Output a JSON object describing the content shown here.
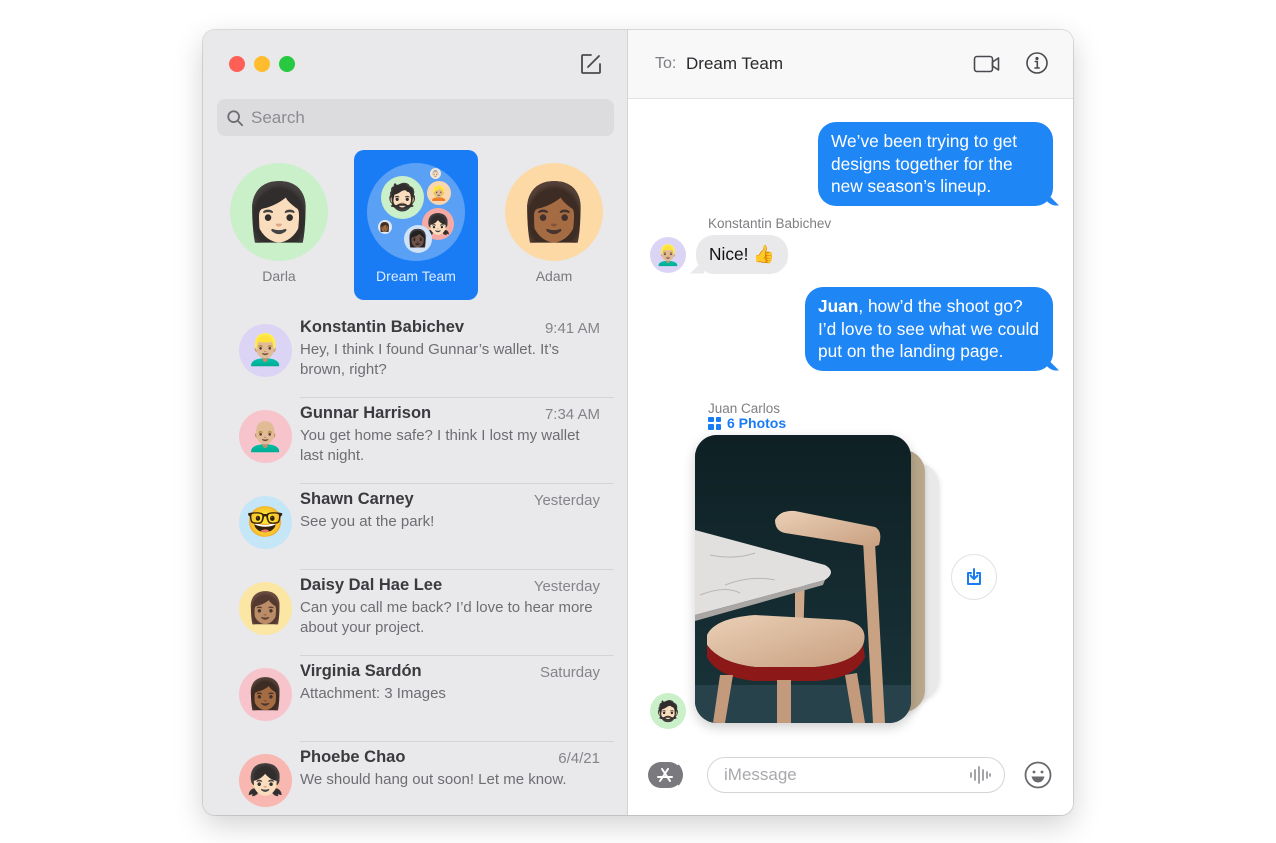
{
  "window": {
    "traffic_lights": [
      "close",
      "minimize",
      "zoom"
    ]
  },
  "sidebar": {
    "compose_icon": "compose-icon",
    "search": {
      "placeholder": "Search",
      "value": ""
    },
    "pinned": [
      {
        "label": "Darla",
        "emoji": "👩🏻",
        "bg": "#c9f0c9",
        "active": false
      },
      {
        "label": "Dream Team",
        "emoji": "",
        "bg": "#5aa1f6",
        "active": true
      },
      {
        "label": "Adam",
        "emoji": "👩🏾",
        "bg": "#fdd9a6",
        "active": false
      }
    ],
    "conversations": [
      {
        "name": "Konstantin Babichev",
        "time": "9:41 AM",
        "preview": "Hey, I think I found Gunnar’s wallet. It’s brown, right?",
        "emoji": "👱🏼‍♂️",
        "bg": "#dcd4f5"
      },
      {
        "name": "Gunnar Harrison",
        "time": "7:34 AM",
        "preview": "You get home safe? I think I lost my wallet last night.",
        "emoji": "👨🏼‍🦲",
        "bg": "#f7c4cc"
      },
      {
        "name": "Shawn Carney",
        "time": "Yesterday",
        "preview": "See you at the park!",
        "emoji": "🤓",
        "bg": "#c5e6f7"
      },
      {
        "name": "Daisy Dal Hae Lee",
        "time": "Yesterday",
        "preview": "Can you call me back? I’d love to hear more about your project.",
        "emoji": "👩🏽",
        "bg": "#fbe6a3"
      },
      {
        "name": "Virginia Sardón",
        "time": "Saturday",
        "preview": "Attachment: 3 Images",
        "emoji": "👩🏾",
        "bg": "#f7c4cc"
      },
      {
        "name": "Phoebe Chao",
        "time": "6/4/21",
        "preview": "We should hang out soon! Let me know.",
        "emoji": "👧🏻",
        "bg": "#f8b7b0"
      }
    ]
  },
  "chat": {
    "to_label": "To:",
    "to_value": "Dream Team",
    "messages": [
      {
        "direction": "outgoing",
        "text": "We’ve been trying to get designs together for the new season’s lineup."
      },
      {
        "direction": "incoming",
        "sender": "Konstantin Babichev",
        "text": "Nice! 👍",
        "emoji": "👱🏼‍♂️"
      },
      {
        "direction": "outgoing",
        "bold": "Juan",
        "text": ", how’d the shoot go? I’d love to see what we could put on the landing page."
      },
      {
        "direction": "incoming",
        "sender": "Juan Carlos",
        "attachment": "6 Photos",
        "emoji": "🧔🏻"
      }
    ],
    "composer": {
      "placeholder": "iMessage",
      "value": ""
    }
  },
  "colors": {
    "accent": "#1a7cf4",
    "outgoing_bubble": "#1f86f5",
    "incoming_bubble": "#e9e9eb",
    "sidebar_bg": "#e9e8ea"
  }
}
